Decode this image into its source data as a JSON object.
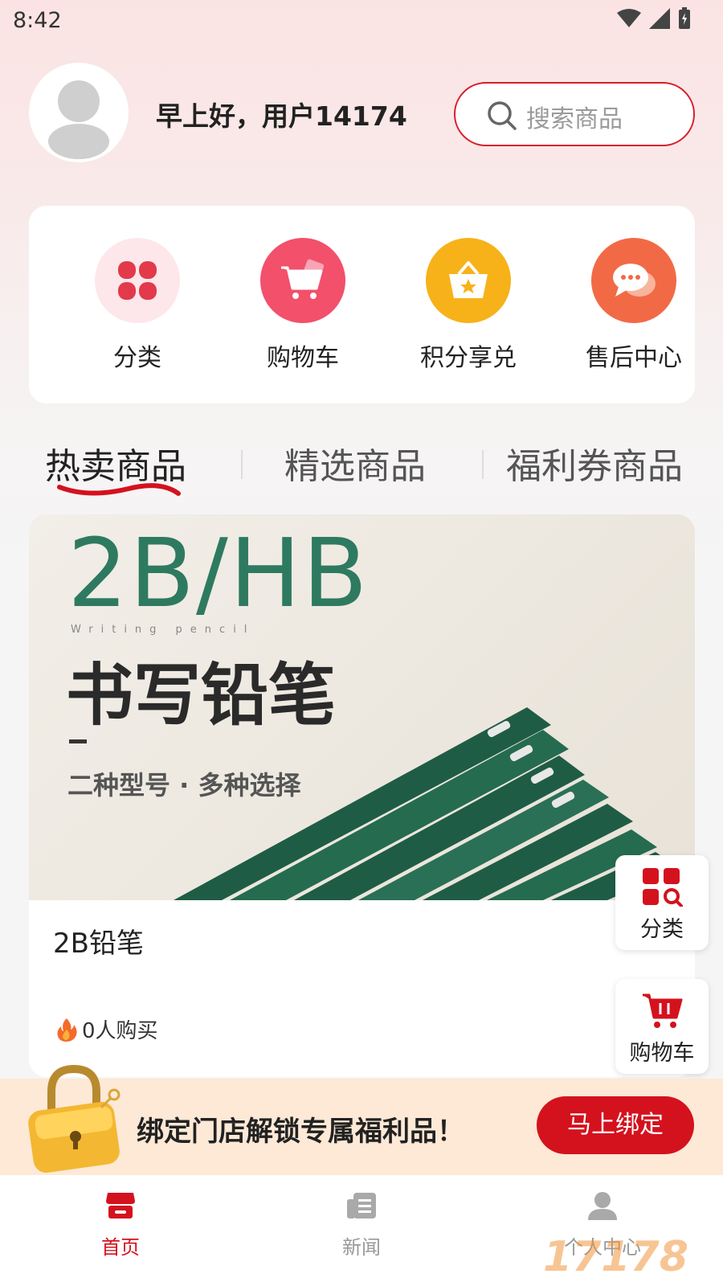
{
  "status_bar": {
    "time": "8:42"
  },
  "header": {
    "greeting": "早上好，用户14174",
    "search_placeholder": "搜索商品"
  },
  "quick_actions": [
    {
      "label": "分类",
      "icon": "clover-icon",
      "color": "#e84a5f"
    },
    {
      "label": "购物车",
      "icon": "cart-icon",
      "color": "#f2506b"
    },
    {
      "label": "积分享兑",
      "icon": "star-basket-icon",
      "color": "#f7b21a"
    },
    {
      "label": "售后中心",
      "icon": "chat-bubble-icon",
      "color": "#f26a45"
    }
  ],
  "tabs": [
    {
      "label": "热卖商品",
      "active": true
    },
    {
      "label": "精选商品",
      "active": false
    },
    {
      "label": "福利券商品",
      "active": false
    }
  ],
  "product": {
    "image_text": {
      "big": "2B/HB",
      "sub_en": "Writing pencil",
      "title": "书写铅笔",
      "caption": "二种型号 · 多种选择"
    },
    "name": "2B铅笔",
    "sold": "0人购买"
  },
  "floating": {
    "category_label": "分类",
    "cart_label": "购物车"
  },
  "bind_banner": {
    "text": "绑定门店解锁专属福利品！",
    "button": "马上绑定"
  },
  "tabbar": [
    {
      "label": "首页",
      "icon": "store-icon",
      "active": true
    },
    {
      "label": "新闻",
      "icon": "news-icon",
      "active": false
    },
    {
      "label": "个人中心",
      "icon": "person-icon",
      "active": false
    }
  ],
  "watermark": "17178",
  "colors": {
    "accent": "#d4121e",
    "brand_green": "#2e7a60"
  }
}
